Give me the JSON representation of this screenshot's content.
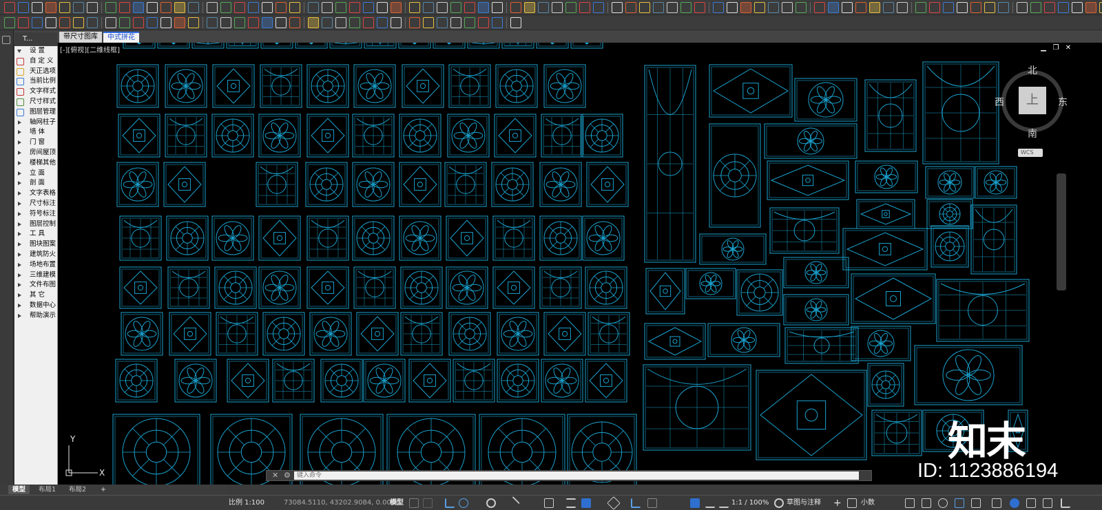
{
  "tabs": {
    "dims_library": "带尺寸图库",
    "pattern": "中式拼花"
  },
  "panel": {
    "head": "T...",
    "items": [
      {
        "label": "设    置",
        "open": true
      },
      {
        "label": "自 定 义",
        "icon": true
      },
      {
        "label": "天正选项",
        "icon": true
      },
      {
        "label": "当前比例",
        "icon": true
      },
      {
        "label": "文字样式",
        "icon": true
      },
      {
        "label": "尺寸样式",
        "icon": true
      },
      {
        "label": "图层管理",
        "icon": true
      },
      {
        "label": "轴网柱子"
      },
      {
        "label": "墙    体"
      },
      {
        "label": "门    窗"
      },
      {
        "label": "房间屋顶"
      },
      {
        "label": "楼梯其他"
      },
      {
        "label": "立    面"
      },
      {
        "label": "剖    面"
      },
      {
        "label": "文字表格"
      },
      {
        "label": "尺寸标注"
      },
      {
        "label": "符号标注"
      },
      {
        "label": "图层控制"
      },
      {
        "label": "工    具"
      },
      {
        "label": "图块图案"
      },
      {
        "label": "建筑防火"
      },
      {
        "label": "场地布置"
      },
      {
        "label": "三维建模"
      },
      {
        "label": "文件布图"
      },
      {
        "label": "其    它"
      },
      {
        "label": "数据中心"
      },
      {
        "label": "帮助演示"
      }
    ]
  },
  "viewport": {
    "label": "[-][俯视][二维线框]",
    "minimize": "▁",
    "restore": "❐",
    "close": "✕",
    "line_color": "#1aa3d0",
    "background": "#000000"
  },
  "viewcube": {
    "north": "北",
    "south": "南",
    "east": "东",
    "west": "西",
    "top": "上",
    "wcs": "WCS"
  },
  "ucs": {
    "x": "X",
    "y": "Y"
  },
  "command": {
    "placeholder": "键入命令",
    "close": "✕",
    "wrench": "🔧"
  },
  "layout_tabs": {
    "model": "模型",
    "layout1": "布局1",
    "layout2": "布局2",
    "add": "+"
  },
  "status": {
    "scale": "比例 1:100",
    "coords": "73084.5110, 43202.9084, 0.0000",
    "model": "模型",
    "annotation_scale": "1:1 / 100%",
    "workspace": "草图与注释",
    "units": "小数"
  },
  "watermark": {
    "logo": "知末",
    "id": "ID: 1123886194"
  }
}
